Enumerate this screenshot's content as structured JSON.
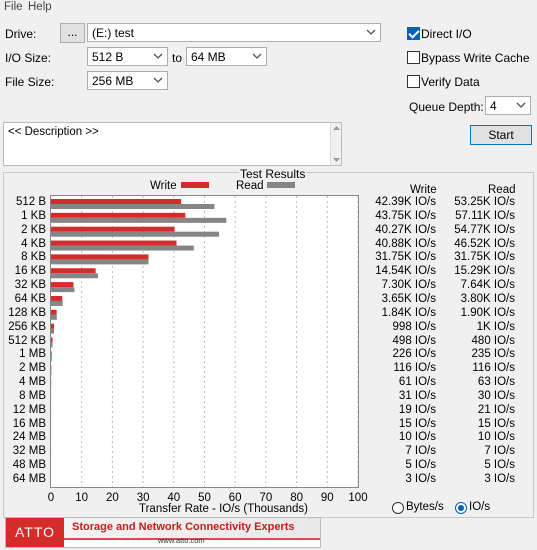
{
  "menu": {
    "items": [
      "File",
      "Help"
    ]
  },
  "drive": {
    "label": "Drive:",
    "browse_label": "...",
    "value": "(E:) test"
  },
  "io_size": {
    "label": "I/O Size:",
    "from": "512 B",
    "to_label": "to",
    "to": "64 MB"
  },
  "file_size": {
    "label": "File Size:",
    "value": "256 MB"
  },
  "options": {
    "direct_io": {
      "label": "Direct I/O",
      "checked": true
    },
    "bypass_write_cache": {
      "label": "Bypass Write Cache",
      "checked": false
    },
    "verify_data": {
      "label": "Verify Data",
      "checked": false
    },
    "queue_depth_label": "Queue Depth:",
    "queue_depth": "4"
  },
  "start_label": "Start",
  "description_text": "<< Description >>",
  "results": {
    "title": "Test Results",
    "write_label": "Write",
    "read_label": "Read",
    "write_header": "Write",
    "read_header": "Read",
    "rows": [
      {
        "size": "512 B",
        "write": "42.39K IO/s",
        "read": "53.25K IO/s"
      },
      {
        "size": "1 KB",
        "write": "43.75K IO/s",
        "read": "57.11K IO/s"
      },
      {
        "size": "2 KB",
        "write": "40.27K IO/s",
        "read": "54.77K IO/s"
      },
      {
        "size": "4 KB",
        "write": "40.88K IO/s",
        "read": "46.52K IO/s"
      },
      {
        "size": "8 KB",
        "write": "31.75K IO/s",
        "read": "31.75K IO/s"
      },
      {
        "size": "16 KB",
        "write": "14.54K IO/s",
        "read": "15.29K IO/s"
      },
      {
        "size": "32 KB",
        "write": "7.30K IO/s",
        "read": "7.64K IO/s"
      },
      {
        "size": "64 KB",
        "write": "3.65K IO/s",
        "read": "3.80K IO/s"
      },
      {
        "size": "128 KB",
        "write": "1.84K IO/s",
        "read": "1.90K IO/s"
      },
      {
        "size": "256 KB",
        "write": "998 IO/s",
        "read": "1K IO/s"
      },
      {
        "size": "512 KB",
        "write": "498 IO/s",
        "read": "480 IO/s"
      },
      {
        "size": "1 MB",
        "write": "226 IO/s",
        "read": "235 IO/s"
      },
      {
        "size": "2 MB",
        "write": "116 IO/s",
        "read": "116 IO/s"
      },
      {
        "size": "4 MB",
        "write": "61 IO/s",
        "read": "63 IO/s"
      },
      {
        "size": "8 MB",
        "write": "31 IO/s",
        "read": "30 IO/s"
      },
      {
        "size": "12 MB",
        "write": "19 IO/s",
        "read": "21 IO/s"
      },
      {
        "size": "16 MB",
        "write": "15 IO/s",
        "read": "15 IO/s"
      },
      {
        "size": "24 MB",
        "write": "10 IO/s",
        "read": "10 IO/s"
      },
      {
        "size": "32 MB",
        "write": "7 IO/s",
        "read": "7 IO/s"
      },
      {
        "size": "48 MB",
        "write": "5 IO/s",
        "read": "5 IO/s"
      },
      {
        "size": "64 MB",
        "write": "3 IO/s",
        "read": "3 IO/s"
      }
    ],
    "units": {
      "bytes_label": "Bytes/s",
      "ios_label": "IO/s",
      "selected": "IO/s"
    }
  },
  "colors": {
    "write": "#d42b2b",
    "read": "#858585",
    "accent": "#0060c0",
    "banner_red": "#d42b2b"
  },
  "banner": {
    "logo": "ATTO",
    "tagline": "Storage and Network Connectivity Experts",
    "url": "www.atto.com"
  },
  "chart_data": {
    "type": "bar",
    "orientation": "horizontal",
    "title": "Test Results",
    "xlabel": "Transfer Rate - IO/s (Thousands)",
    "ylabel": "",
    "xlim": [
      0,
      100
    ],
    "xticks": [
      0,
      10,
      20,
      30,
      40,
      50,
      60,
      70,
      80,
      90,
      100
    ],
    "grid": true,
    "legend": "top",
    "categories": [
      "512 B",
      "1 KB",
      "2 KB",
      "4 KB",
      "8 KB",
      "16 KB",
      "32 KB",
      "64 KB",
      "128 KB",
      "256 KB",
      "512 KB",
      "1 MB",
      "2 MB",
      "4 MB",
      "8 MB",
      "12 MB",
      "16 MB",
      "24 MB",
      "32 MB",
      "48 MB",
      "64 MB"
    ],
    "series": [
      {
        "name": "Write",
        "values": [
          42.39,
          43.75,
          40.27,
          40.88,
          31.75,
          14.54,
          7.3,
          3.65,
          1.84,
          0.998,
          0.498,
          0.226,
          0.116,
          0.061,
          0.031,
          0.019,
          0.015,
          0.01,
          0.007,
          0.005,
          0.003
        ]
      },
      {
        "name": "Read",
        "values": [
          53.25,
          57.11,
          54.77,
          46.52,
          31.75,
          15.29,
          7.64,
          3.8,
          1.9,
          1.0,
          0.48,
          0.235,
          0.116,
          0.063,
          0.03,
          0.021,
          0.015,
          0.01,
          0.007,
          0.005,
          0.003
        ]
      }
    ]
  }
}
